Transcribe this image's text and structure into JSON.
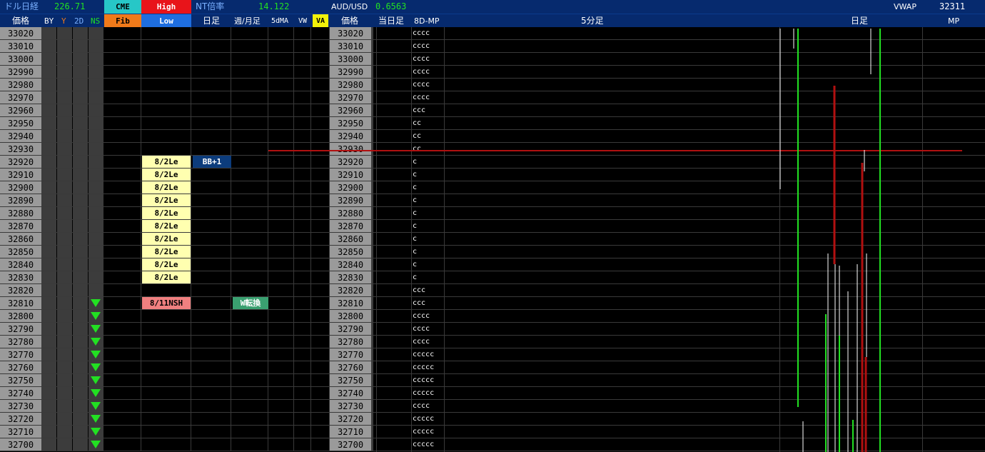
{
  "header": {
    "row1": {
      "dollar_nikkei_label": "ドル日経",
      "dollar_nikkei_value": "226.71",
      "cme_label": "CME",
      "high_label": "High",
      "nt_ratio_label": "NT倍率",
      "nt_ratio_value": "14.122",
      "audusd_label": "AUD/USD",
      "audusd_value": "0.6563",
      "vwap_label": "VWAP",
      "vwap_value": "32311"
    },
    "row2": {
      "price_label": "価格",
      "by_label": "BY",
      "y_label": "Y",
      "twod_label": "2D",
      "ns_label": "NS",
      "fib_label": "Fib",
      "low_label": "Low",
      "daily_label": "日足",
      "weekly_monthly_label": "週/月足",
      "fivedma_label": "5dMA",
      "vw_label": "VW",
      "va_label": "VA",
      "price2_label": "価格",
      "today_label": "当日足",
      "eightd_mp_label": "8D-MP",
      "five_min_label": "5分足",
      "daily2_label": "日足",
      "mp_label": "MP"
    }
  },
  "rows": [
    {
      "price": "33020",
      "tpo": "cccc"
    },
    {
      "price": "33010",
      "tpo": "cccc"
    },
    {
      "price": "33000",
      "tpo": "cccc"
    },
    {
      "price": "32990",
      "tpo": "cccc"
    },
    {
      "price": "32980",
      "tpo": "cccc"
    },
    {
      "price": "32970",
      "tpo": "cccc"
    },
    {
      "price": "32960",
      "tpo": "ccc"
    },
    {
      "price": "32950",
      "tpo": "cc"
    },
    {
      "price": "32940",
      "tpo": "cc"
    },
    {
      "price": "32930",
      "tpo": "cc"
    },
    {
      "price": "32920",
      "tpo": "c"
    },
    {
      "price": "32910",
      "tpo": "c"
    },
    {
      "price": "32900",
      "tpo": "c"
    },
    {
      "price": "32890",
      "tpo": "c"
    },
    {
      "price": "32880",
      "tpo": "c"
    },
    {
      "price": "32870",
      "tpo": "c"
    },
    {
      "price": "32860",
      "tpo": "c"
    },
    {
      "price": "32850",
      "tpo": "c"
    },
    {
      "price": "32840",
      "tpo": "c"
    },
    {
      "price": "32830",
      "tpo": "c"
    },
    {
      "price": "32820",
      "tpo": "ccc"
    },
    {
      "price": "32810",
      "tpo": "ccc"
    },
    {
      "price": "32800",
      "tpo": "cccc"
    },
    {
      "price": "32790",
      "tpo": "cccc"
    },
    {
      "price": "32780",
      "tpo": "cccc"
    },
    {
      "price": "32770",
      "tpo": "ccccc"
    },
    {
      "price": "32760",
      "tpo": "ccccc"
    },
    {
      "price": "32750",
      "tpo": "ccccc"
    },
    {
      "price": "32740",
      "tpo": "ccccc"
    },
    {
      "price": "32730",
      "tpo": "cccc"
    },
    {
      "price": "32720",
      "tpo": "ccccc"
    },
    {
      "price": "32710",
      "tpo": "ccccc"
    },
    {
      "price": "32700",
      "tpo": "ccccc"
    }
  ],
  "badges": {
    "fib_level": "8/2Le",
    "nsh_label": "8/11NSH",
    "bb_label": "BB+1",
    "reversal_label": "W転換"
  },
  "colors": {
    "header_bg": "#062a6e",
    "cme_bg": "#27c7c7",
    "high_bg": "#e8141a",
    "fib_bg": "#f07a1a",
    "low_bg": "#1e6ee0",
    "va_bg": "#f2f20a",
    "fib_cell_bg": "#ffffb0",
    "nsh_bg": "#f08080",
    "bb_bg": "#0c3c7c",
    "reversal_bg": "#3aa070",
    "green_value": "#22e022",
    "triangle_green": "#22e022",
    "red_line": "#b01010"
  },
  "icons": {
    "down_triangle": "down-triangle-icon"
  }
}
